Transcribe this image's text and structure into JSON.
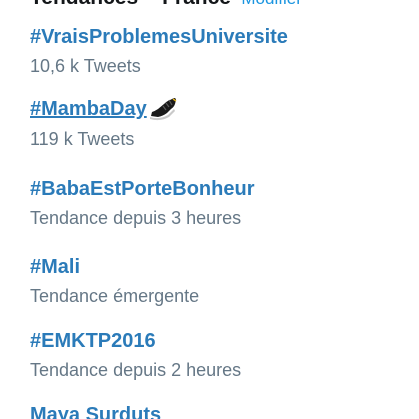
{
  "header": {
    "title": "Tendances",
    "separator": "·",
    "location": "France",
    "change_label": "Modifier"
  },
  "trends": [
    {
      "name": "#VraisProblemesUniversite",
      "meta": "10,6 k Tweets"
    },
    {
      "name": "#MambaDay",
      "meta": "119 k Tweets",
      "emoji": "basketball-shoe-icon"
    },
    {
      "name": "#BabaEstPorteBonheur",
      "meta": "Tendance depuis 3 heures"
    },
    {
      "name": "#Mali",
      "meta": "Tendance émergente"
    },
    {
      "name": "#EMKTP2016",
      "meta": "Tendance depuis 2 heures"
    },
    {
      "name": "Maya Surduts",
      "meta": ""
    }
  ],
  "colors": {
    "trend_link": "#2b7bb9",
    "meta_text": "#657786",
    "header_link": "#1b95e0"
  }
}
